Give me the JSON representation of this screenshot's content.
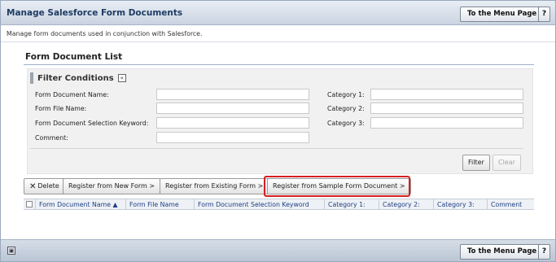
{
  "header": {
    "title": "Manage Salesforce Form Documents",
    "menu_button": "To the Menu Page",
    "help_button": "?"
  },
  "description": "Manage form documents used in conjunction with Salesforce.",
  "panel": {
    "title": "Form Document List",
    "filter": {
      "heading": "Filter Conditions",
      "collapse_icon": "«",
      "fields": {
        "form_document_name": {
          "label": "Form Document Name:",
          "value": ""
        },
        "form_file_name": {
          "label": "Form File Name:",
          "value": ""
        },
        "selection_keyword": {
          "label": "Form Document Selection Keyword:",
          "value": ""
        },
        "comment": {
          "label": "Comment:",
          "value": ""
        },
        "category1": {
          "label": "Category 1:",
          "value": ""
        },
        "category2": {
          "label": "Category 2:",
          "value": ""
        },
        "category3": {
          "label": "Category 3:",
          "value": ""
        }
      },
      "filter_button": "Filter",
      "clear_button": "Clear"
    },
    "actions": {
      "delete": "Delete",
      "delete_icon": "✕",
      "register_new": "Register from New Form >",
      "register_existing": "Register from Existing Form >",
      "register_sample": "Register from Sample Form Document >"
    },
    "table": {
      "columns": [
        "Form Document Name ▲",
        "Form File Name",
        "Form Document Selection Keyword",
        "Category 1:",
        "Category 2:",
        "Category 3:",
        "Comment"
      ]
    }
  },
  "footer": {
    "menu_button": "To the Menu Page",
    "help_button": "?",
    "icon": "▣"
  },
  "colors": {
    "header_title": "#1f3b63",
    "column_header_text": "#1f3f86",
    "highlight": "#d61f1f"
  }
}
